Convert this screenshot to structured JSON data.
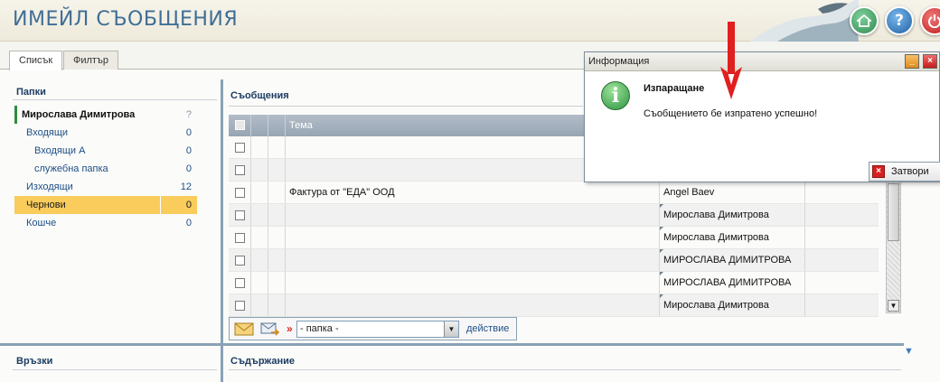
{
  "header": {
    "title": "ИМЕЙЛ СЪОБЩЕНИЯ"
  },
  "tabs": [
    {
      "label": "Списък"
    },
    {
      "label": "Филтър"
    }
  ],
  "folders": {
    "title": "Папки",
    "items": [
      {
        "label": "Мирослава Димитрова",
        "count": "?"
      },
      {
        "label": "Входящи",
        "count": "0"
      },
      {
        "label": "Входящи А",
        "count": "0"
      },
      {
        "label": "служебна папка",
        "count": "0"
      },
      {
        "label": "Изходящи",
        "count": "12"
      },
      {
        "label": "Чернови",
        "count": "0"
      },
      {
        "label": "Кошче",
        "count": "0"
      }
    ]
  },
  "messages": {
    "title": "Съобщения",
    "columns": {
      "subject": "Тема"
    },
    "rows": [
      {
        "subject": "",
        "sender": ""
      },
      {
        "subject": "",
        "sender": ""
      },
      {
        "subject": "Фактура от \"ЕДА\" ООД",
        "sender": "Angel Baev"
      },
      {
        "subject": "",
        "sender": "Мирослава Димитрова"
      },
      {
        "subject": "",
        "sender": "Мирослава Димитрова"
      },
      {
        "subject": "",
        "sender": "МИРОСЛАВА ДИМИТРОВА"
      },
      {
        "subject": "",
        "sender": "МИРОСЛАВА ДИМИТРОВА"
      },
      {
        "subject": "",
        "sender": "Мирослава Димитрова"
      }
    ]
  },
  "toolbar": {
    "raquo": "»",
    "folder_select": "- папка -",
    "action": "действие"
  },
  "links": {
    "title": "Връзки"
  },
  "body": {
    "title": "Съдържание"
  },
  "dialog": {
    "title": "Информация",
    "heading": "Изпаращане",
    "message": "Съобщението бе изпратено успешно!",
    "close_label": "Затвори"
  },
  "icons": {
    "home": "home-icon",
    "help": "help-icon",
    "power": "power-icon",
    "info": "info-icon",
    "close": "close-icon",
    "minimize": "minimize-icon"
  },
  "colors": {
    "title": "#3f6e96",
    "accent_selected": "#f9cc5c",
    "owner_bar": "#2e8b3e",
    "link": "#1e4f86"
  }
}
